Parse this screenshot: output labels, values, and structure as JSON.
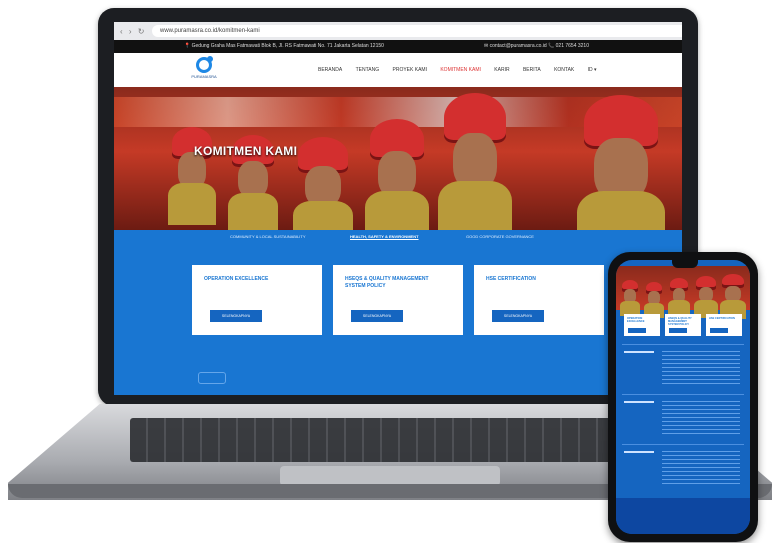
{
  "browser": {
    "url": "www.puramasra.co.id/komitmen-kami",
    "nav_glyphs": "‹ › ↻"
  },
  "infobar": {
    "address": "📍 Gedung Graha Mas Fatmawati Blok B, Jl. RS Fatmawati No. 71 Jakarta Selatan 12150",
    "contact": "✉ contact@puramasra.co.id   📞 021 7654 3210"
  },
  "site": {
    "logo_text": "PURAMASRA",
    "menu": [
      "BERANDA",
      "TENTANG",
      "PROYEK KAMI",
      "KOMITMEN KAMI",
      "KARIR",
      "BERITA",
      "KONTAK",
      "ID ▾"
    ],
    "active_menu_index": 3
  },
  "hero": {
    "title": "KOMITMEN KAMI"
  },
  "tabs": [
    {
      "label": "COMMUNITY & LOCAL SUSTAINABILITY",
      "selected": false
    },
    {
      "label": "HEALTH, SAFETY & ENVIRONMENT",
      "selected": true
    },
    {
      "label": "GOOD CORPORATE GOVERNANCE",
      "selected": false
    }
  ],
  "cards": [
    {
      "title": "OPERATION EXCELLENCE",
      "button": "SELENGKAPNYA"
    },
    {
      "title": "HSEQS & QUALITY MANAGEMENT SYSTEM POLICY",
      "button": "SELENGKAPNYA"
    },
    {
      "title": "HSE CERTIFICATION",
      "button": "SELENGKAPNYA"
    }
  ],
  "colors": {
    "primary_blue": "#1976d2",
    "button_blue": "#1565c0",
    "helmet_red": "#d32f2f",
    "active_menu": "#dd3333"
  }
}
